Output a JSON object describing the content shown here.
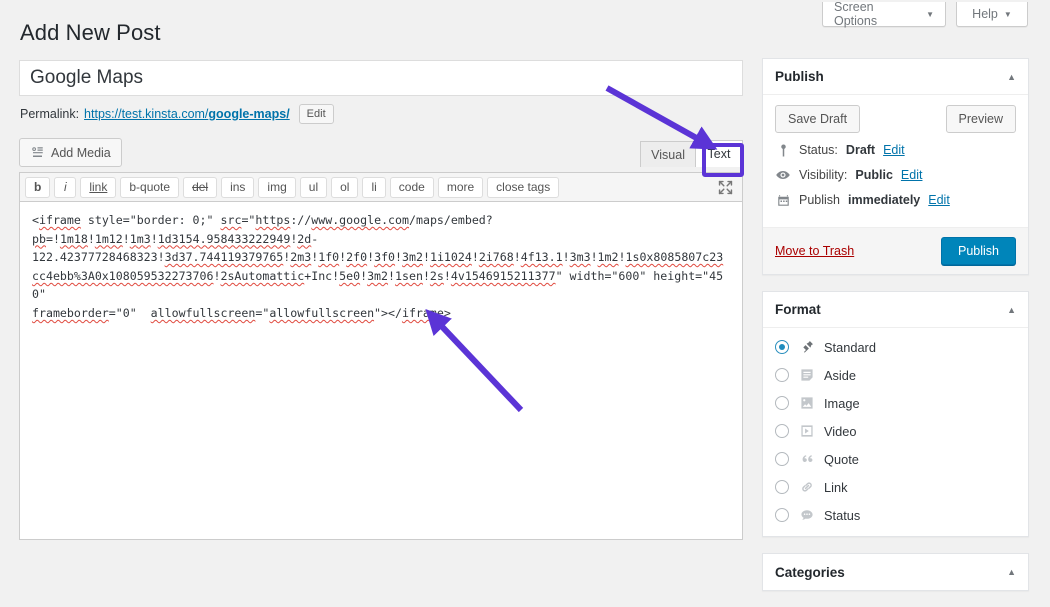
{
  "topbar": {
    "screen_options_label": "Screen Options",
    "help_label": "Help",
    "caret": "▼"
  },
  "page": {
    "title": "Add New Post"
  },
  "post": {
    "title_value": "Google Maps",
    "permalink_label": "Permalink:",
    "permalink_base": "https://test.kinsta.com/",
    "permalink_slug": "google-maps/",
    "permalink_edit_label": "Edit"
  },
  "editor": {
    "add_media_label": "Add Media",
    "media_icon": "media-icon",
    "tabs": [
      {
        "label": "Visual",
        "active": false,
        "name": "visual"
      },
      {
        "label": "Text",
        "active": true,
        "name": "text"
      }
    ],
    "quicktags": [
      "b",
      "i",
      "link",
      "b-quote",
      "del",
      "ins",
      "img",
      "ul",
      "ol",
      "li",
      "code",
      "more",
      "close tags"
    ],
    "fullscreen_icon": "expand-arrows-icon",
    "code_parts": [
      {
        "t": "<",
        "sp": false
      },
      {
        "t": "iframe",
        "sp": true
      },
      {
        "t": " style=\"border: 0;\" ",
        "sp": false
      },
      {
        "t": "src",
        "sp": true
      },
      {
        "t": "=\"",
        "sp": false
      },
      {
        "t": "https",
        "sp": true
      },
      {
        "t": "://",
        "sp": false
      },
      {
        "t": "www.google.com",
        "sp": true
      },
      {
        "t": "/maps/embed?\n",
        "sp": false
      },
      {
        "t": "pb",
        "sp": true
      },
      {
        "t": "=!",
        "sp": false
      },
      {
        "t": "1m18",
        "sp": true
      },
      {
        "t": "!",
        "sp": false
      },
      {
        "t": "1m12",
        "sp": true
      },
      {
        "t": "!",
        "sp": false
      },
      {
        "t": "1m3",
        "sp": true
      },
      {
        "t": "!",
        "sp": false
      },
      {
        "t": "1d3154.958433222949",
        "sp": true
      },
      {
        "t": "!",
        "sp": false
      },
      {
        "t": "2d",
        "sp": true
      },
      {
        "t": "-\n122.42377728468323!",
        "sp": false
      },
      {
        "t": "3d37.744119379765",
        "sp": true
      },
      {
        "t": "!",
        "sp": false
      },
      {
        "t": "2m3",
        "sp": true
      },
      {
        "t": "!",
        "sp": false
      },
      {
        "t": "1f0",
        "sp": true
      },
      {
        "t": "!",
        "sp": false
      },
      {
        "t": "2f0",
        "sp": true
      },
      {
        "t": "!",
        "sp": false
      },
      {
        "t": "3f0",
        "sp": true
      },
      {
        "t": "!",
        "sp": false
      },
      {
        "t": "3m2",
        "sp": true
      },
      {
        "t": "!",
        "sp": false
      },
      {
        "t": "1i1024",
        "sp": true
      },
      {
        "t": "!",
        "sp": false
      },
      {
        "t": "2i768",
        "sp": true
      },
      {
        "t": "!",
        "sp": false
      },
      {
        "t": "4f13.1",
        "sp": true
      },
      {
        "t": "!",
        "sp": false
      },
      {
        "t": "3m3",
        "sp": true
      },
      {
        "t": "!",
        "sp": false
      },
      {
        "t": "1m2",
        "sp": true
      },
      {
        "t": "!",
        "sp": false
      },
      {
        "t": "1s0x8085807c23cc4ebb%3A0x108059532273706",
        "sp": true
      },
      {
        "t": "!",
        "sp": false
      },
      {
        "t": "2sAutomattic",
        "sp": true
      },
      {
        "t": "+Inc!",
        "sp": false
      },
      {
        "t": "5e0",
        "sp": true
      },
      {
        "t": "!",
        "sp": false
      },
      {
        "t": "3m2",
        "sp": true
      },
      {
        "t": "!",
        "sp": false
      },
      {
        "t": "1sen",
        "sp": true
      },
      {
        "t": "!",
        "sp": false
      },
      {
        "t": "2s",
        "sp": true
      },
      {
        "t": "!",
        "sp": false
      },
      {
        "t": "4v1546915211377",
        "sp": true
      },
      {
        "t": "\" width=\"600\" height=\"450\"\n",
        "sp": false
      },
      {
        "t": "frameborder",
        "sp": true
      },
      {
        "t": "=\"0\"  ",
        "sp": false
      },
      {
        "t": "allowfullscreen",
        "sp": true
      },
      {
        "t": "=\"",
        "sp": false
      },
      {
        "t": "allowfullscreen",
        "sp": true
      },
      {
        "t": "\"></",
        "sp": false
      },
      {
        "t": "iframe",
        "sp": true
      },
      {
        "t": ">",
        "sp": false
      }
    ],
    "code_plain": "<iframe style=\"border: 0;\" src=\"https://www.google.com/maps/embed?pb=!1m18!1m12!1m3!1d3154.958433222949!2d-122.42377728468323!3d37.744119379765!2m3!1f0!2f0!3f0!3m2!1i1024!2i768!4f13.1!3m3!1m2!1s0x8085807c23cc4ebb%3A0x108059532273706!2sAutomattic+Inc!5e0!3m2!1sen!2s!4v1546915211377\" width=\"600\" height=\"450\" frameborder=\"0\" allowfullscreen=\"allowfullscreen\"></iframe>"
  },
  "sidebar": {
    "publish": {
      "title": "Publish",
      "toggle_icon": "▲",
      "save_draft_label": "Save Draft",
      "preview_label": "Preview",
      "status_icon": "pin-icon",
      "status_label": "Status:",
      "status_value": "Draft",
      "status_edit": "Edit",
      "visibility_icon": "eye-icon",
      "visibility_label": "Visibility:",
      "visibility_value": "Public",
      "visibility_edit": "Edit",
      "schedule_icon": "calendar-icon",
      "schedule_label": "Publish",
      "schedule_value": "immediately",
      "schedule_edit": "Edit",
      "trash_label": "Move to Trash",
      "publish_label": "Publish",
      "publish_color": "#0085ba"
    },
    "format": {
      "title": "Format",
      "toggle_icon": "▲",
      "options": [
        {
          "label": "Standard",
          "icon": "pin-icon",
          "checked": true
        },
        {
          "label": "Aside",
          "icon": "aside-icon",
          "checked": false
        },
        {
          "label": "Image",
          "icon": "image-icon",
          "checked": false
        },
        {
          "label": "Video",
          "icon": "video-icon",
          "checked": false
        },
        {
          "label": "Quote",
          "icon": "quote-icon",
          "checked": false
        },
        {
          "label": "Link",
          "icon": "link-icon",
          "checked": false
        },
        {
          "label": "Status",
          "icon": "status-icon",
          "checked": false
        }
      ]
    },
    "categories": {
      "title": "Categories",
      "toggle_icon": "▲"
    }
  },
  "annotations": {
    "color": "#5b34d6",
    "highlight_target": "text-tab",
    "arrows": [
      {
        "name": "arrow-to-text-tab",
        "from": [
          607,
          88
        ],
        "to": [
          712,
          147
        ]
      },
      {
        "name": "arrow-to-iframe-close",
        "from": [
          521,
          410
        ],
        "to": [
          428,
          312
        ]
      }
    ]
  }
}
